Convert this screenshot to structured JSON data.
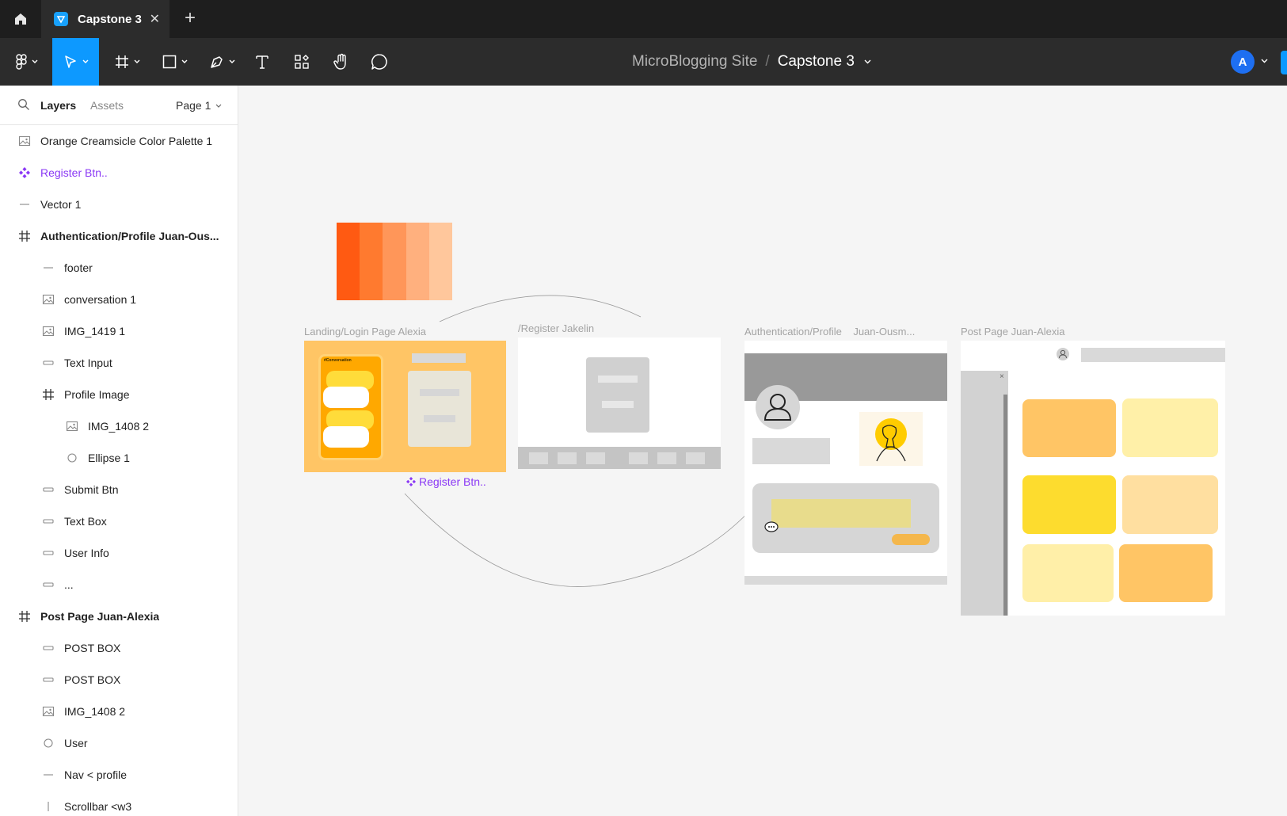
{
  "tabbar": {
    "tab_title": "Capstone 3",
    "close_glyph": "✕",
    "new_tab_glyph": "+"
  },
  "toolbar": {
    "breadcrumb_parent": "MicroBlogging Site",
    "breadcrumb_sep": "/",
    "breadcrumb_current": "Capstone 3",
    "avatar_letter": "A"
  },
  "panel": {
    "tab_layers": "Layers",
    "tab_assets": "Assets",
    "page_label": "Page 1"
  },
  "layers": [
    {
      "name": "Orange Creamsicle Color Palette 1",
      "icon": "image-icon"
    },
    {
      "name": "Register Btn..",
      "icon": "component-icon"
    },
    {
      "name": "Vector 1",
      "icon": "line-icon"
    },
    {
      "name": "Authentication/Profile Juan-Ous...",
      "icon": "frame-icon"
    },
    {
      "name": "footer",
      "icon": "line-icon"
    },
    {
      "name": "conversation 1",
      "icon": "image-icon"
    },
    {
      "name": "IMG_1419 1",
      "icon": "image-icon"
    },
    {
      "name": "Text Input",
      "icon": "rectangle-icon"
    },
    {
      "name": "Profile Image",
      "icon": "frame-icon"
    },
    {
      "name": "IMG_1408 2",
      "icon": "image-icon"
    },
    {
      "name": "Ellipse 1",
      "icon": "ellipse-icon"
    },
    {
      "name": "Submit Btn",
      "icon": "rectangle-icon"
    },
    {
      "name": "Text Box",
      "icon": "rectangle-icon"
    },
    {
      "name": "User Info",
      "icon": "rectangle-icon"
    },
    {
      "name": "...",
      "icon": "rectangle-icon"
    },
    {
      "name": "Post Page Juan-Alexia",
      "icon": "frame-icon"
    },
    {
      "name": "POST BOX",
      "icon": "rectangle-icon"
    },
    {
      "name": "POST BOX",
      "icon": "rectangle-icon"
    },
    {
      "name": "IMG_1408 2",
      "icon": "image-icon"
    },
    {
      "name": "User",
      "icon": "ellipse-icon"
    },
    {
      "name": "Nav < profile",
      "icon": "line-icon"
    },
    {
      "name": "Scrollbar <w3",
      "icon": "vertical-line-icon"
    }
  ],
  "canvas": {
    "frame_landing": "Landing/Login Page Alexia",
    "frame_register": "/Register Jakelin",
    "frame_auth_a": "Authentication/Profile",
    "frame_auth_b": "Juan-Ousm...",
    "frame_post": "Post Page Juan-Alexia",
    "component_label": "Register Btn..",
    "conversation_title": "#Conversation",
    "close_glyph": "×"
  },
  "colors": {
    "accent": "#0d99ff",
    "component": "#8a38f5",
    "palette": [
      "#ff5a12",
      "#ff7a2f",
      "#ff9659",
      "#ffb07e",
      "#ffc79c"
    ]
  }
}
